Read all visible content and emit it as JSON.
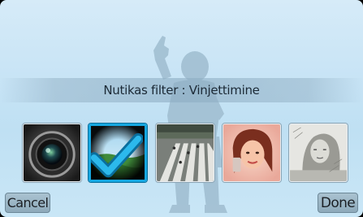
{
  "header": {
    "title": "Nutikas filter : Vinjettimine"
  },
  "filters": [
    {
      "name": "camera-lens"
    },
    {
      "name": "vignette",
      "selected": true
    },
    {
      "name": "miniature"
    },
    {
      "name": "soft-portrait"
    },
    {
      "name": "sketch"
    }
  ],
  "footer": {
    "cancel_label": "Cancel",
    "done_label": "Done"
  },
  "colors": {
    "accent": "#16a7e0",
    "background": "#c6e3f5"
  }
}
